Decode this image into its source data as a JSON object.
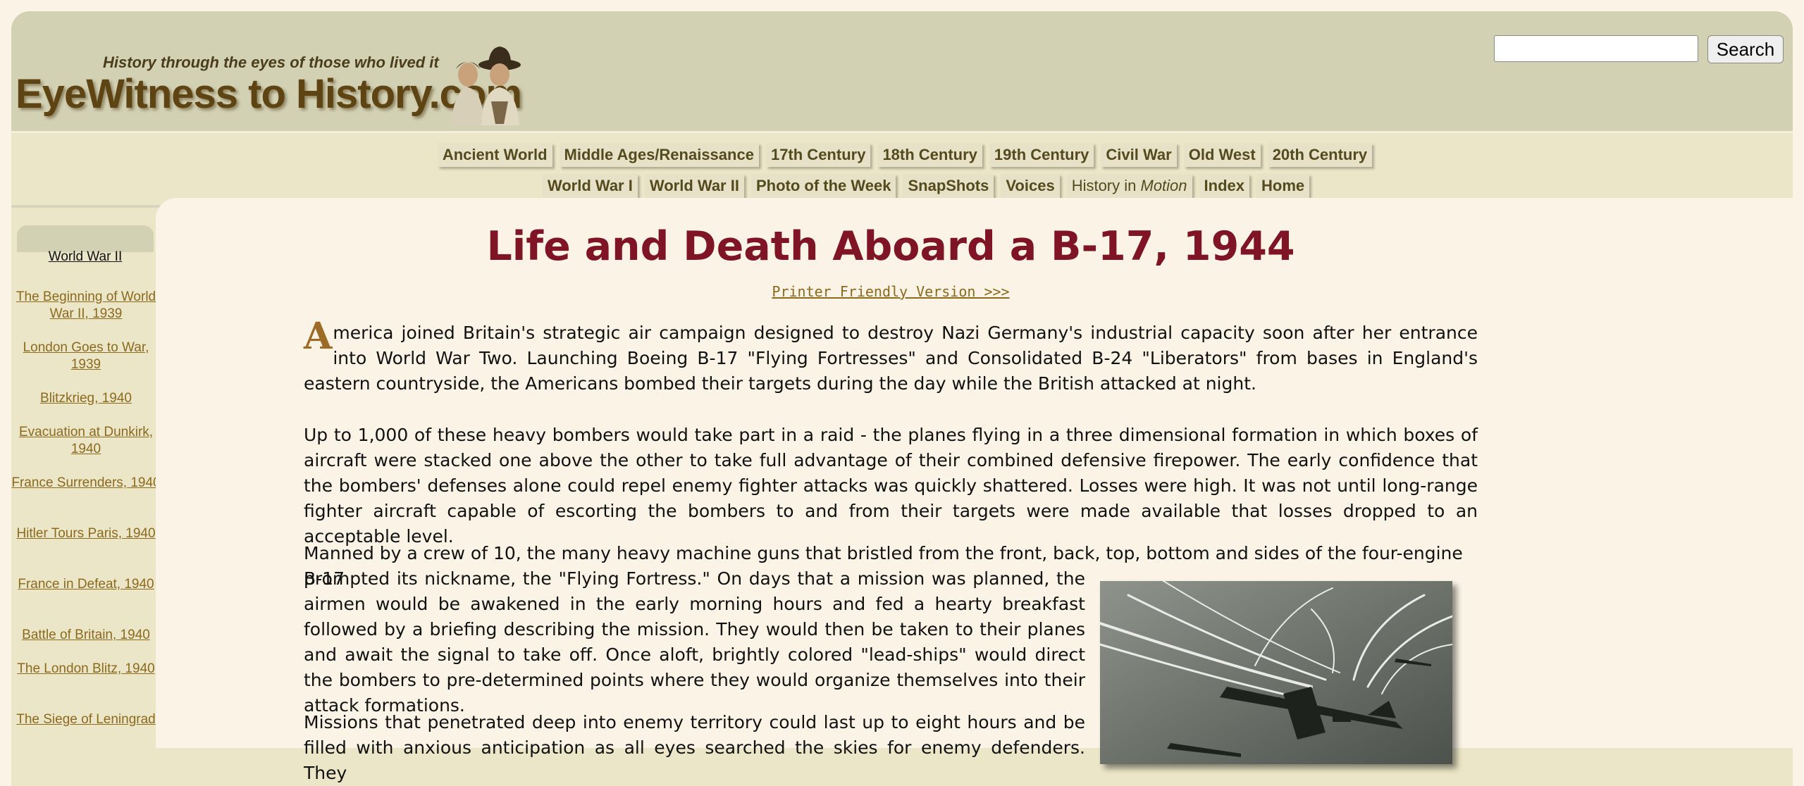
{
  "site": {
    "tagline": "History through the eyes of those who lived it",
    "logo": "EyeWitness to History.com"
  },
  "search": {
    "placeholder": "",
    "button_label": "Search"
  },
  "nav": {
    "row1": [
      "Ancient World",
      "Middle Ages/Renaissance",
      "17th Century",
      "18th Century",
      "19th Century",
      "Civil War",
      "Old West",
      "20th Century"
    ],
    "row2": {
      "world_war_1": "World War I",
      "world_war_2": "World War II",
      "photo_of_week": "Photo of the Week",
      "snapshots": "SnapShots",
      "voices": "Voices",
      "history_in": "History in",
      "motion": "Motion",
      "index": "Index",
      "home": "Home"
    }
  },
  "sidebar": {
    "title": "World War II",
    "items": [
      {
        "label": "The Beginning of World War II, 1939"
      },
      {
        "label": "London Goes to War, 1939"
      },
      {
        "label": "Blitzkrieg, 1940"
      },
      {
        "label": "Evacuation at Dunkirk, 1940"
      },
      {
        "label": "France Surrenders, 1940"
      },
      {
        "label": "Hitler Tours Paris, 1940"
      },
      {
        "label": "France in Defeat, 1940"
      },
      {
        "label": "Battle of Britain, 1940"
      },
      {
        "label": "The London Blitz, 1940"
      },
      {
        "label": "The Siege of Leningrad"
      }
    ]
  },
  "article": {
    "title": "Life and Death Aboard a B-17, 1944",
    "printer_link": "Printer Friendly Version >>>",
    "dropcap": "A",
    "p1_rest": "merica joined Britain's strategic air campaign designed to destroy Nazi Germany's industrial capacity soon after her entrance into World War Two. Launching Boeing B-17 \"Flying Fortresses\" and Consolidated B-24 \"Liberators\" from bases in England's eastern countryside, the Americans bombed their targets during the day while the British attacked at night.",
    "p2": "Up to 1,000 of these heavy bombers would take part in a raid - the planes flying in a three dimensional formation in which boxes of aircraft were stacked one above the other to take full advantage of their combined defensive firepower. The early confidence that the bombers' defenses alone could repel enemy fighter attacks was quickly shattered. Losses were high. It was not until long-range fighter aircraft capable of escorting the bombers to and from their targets were made available that losses dropped to an acceptable level.",
    "p3_line1": "Manned by a crew of 10, the many heavy machine guns that bristled from the front, back, top, bottom and sides of the four-engine B-17",
    "p3_rest": "prompted its nickname, the \"Flying Fortress.\" On days that a mission was planned, the airmen would be awakened in the early morning hours and fed a hearty breakfast followed by a briefing describing the mission. They would then be taken to their planes and await the signal to take off. Once aloft, brightly colored \"lead-ships\" would direct the bombers to pre-determined points where they would organize themselves into their attack formations.",
    "p4": "Missions that penetrated deep into enemy territory could last up to eight hours and be filled with anxious anticipation as all eyes searched the skies for enemy defenders. They"
  },
  "colors": {
    "header_bg": "#d3d1b4",
    "page_bg": "#fbf4e6",
    "sidebar_bg": "#ece6c8",
    "title_red": "#7e1425",
    "link_brown": "#8b6a1e"
  }
}
